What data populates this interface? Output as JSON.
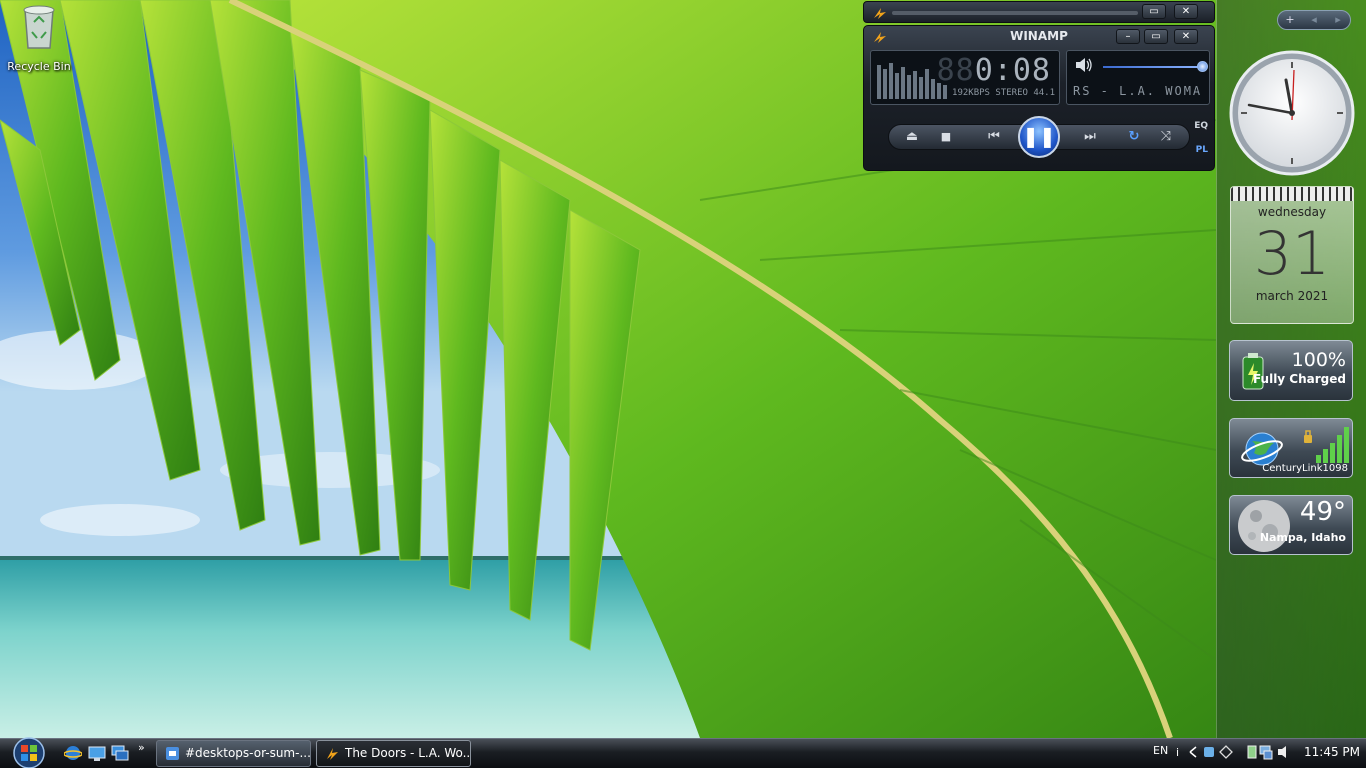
{
  "desktop": {
    "icons": [
      {
        "label": "Recycle Bin",
        "icon": "recycle-bin-icon"
      }
    ]
  },
  "sidebar": {
    "controls": {
      "add": "+",
      "prev": "◂",
      "next": "▸"
    },
    "calendar": {
      "weekday": "wednesday",
      "day": "31",
      "month": "march 2021"
    },
    "battery": {
      "percent": "100%",
      "status": "Fully Charged"
    },
    "network": {
      "ssid": "CenturyLink1098",
      "signal_bars": 5
    },
    "weather": {
      "temperature": "49°",
      "location": "Nampa, Idaho"
    }
  },
  "winamp": {
    "title": "WINAMP",
    "time_dim": "88",
    "time": "0:08",
    "info": "192KBPS STEREO 44.1",
    "marquee": "RS - L.A. WOMA",
    "eq_label": "EQ",
    "pl_label": "PL",
    "controls": {
      "eject": "⏏",
      "stop": "■",
      "prev": "⏮",
      "pause": "❚❚",
      "next": "⏭",
      "repeat": "↻",
      "shuffle": "⤨"
    },
    "window": {
      "minimize": "–",
      "shade": "▭",
      "close": "✕"
    }
  },
  "taskbar": {
    "tasks": [
      {
        "label": "#desktops-or-sum-...",
        "icon": "discord-icon"
      },
      {
        "label": "The Doors - L.A. Wo...",
        "icon": "winamp-icon"
      }
    ],
    "quicklaunch_more": "»",
    "language": "EN",
    "clock": "11:45 PM"
  }
}
